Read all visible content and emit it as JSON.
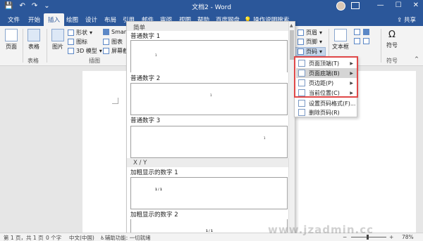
{
  "window": {
    "title": "文档2 - Word",
    "share_label": "共享",
    "tell_me": "操作说明搜索"
  },
  "tabs": [
    "文件",
    "开始",
    "插入",
    "绘图",
    "设计",
    "布局",
    "引用",
    "邮件",
    "审阅",
    "视图",
    "帮助",
    "百度网盘"
  ],
  "active_tab": "插入",
  "ribbon": {
    "pages_label": "页面",
    "table_label": "表格",
    "table_group": "表格",
    "pictures_label": "图片",
    "shapes_label": "形状",
    "icons_label": "图标",
    "model3d_label": "3D 模型",
    "smartart_label": "SmartArt",
    "chart_label": "图表",
    "screenshot_label": "屏幕截图",
    "illustrations_group": "插图",
    "header_label": "页眉",
    "footer_label": "页脚",
    "page_number_label": "页码",
    "textbox_label": "文本框",
    "symbol_label": "符号",
    "symbol_group": "符号",
    "omega": "Ω"
  },
  "gallery": {
    "section1": "简单",
    "item1": "普通数字 1",
    "item2": "普通数字 2",
    "item3": "普通数字 3",
    "section2": "X / Y",
    "item4": "加粗显示的数字 1",
    "item5": "加粗显示的数字 2",
    "num1": "1",
    "num_xy": "1 / 1"
  },
  "page_number_menu": {
    "items": [
      {
        "label": "页面顶端(T)",
        "submenu": true
      },
      {
        "label": "页面底端(B)",
        "submenu": true,
        "highlighted": true
      },
      {
        "label": "页边距(P)",
        "submenu": true
      },
      {
        "label": "当前位置(C)",
        "submenu": true
      },
      {
        "label": "设置页码格式(F)...",
        "submenu": false
      },
      {
        "label": "删除页码(R)",
        "submenu": false
      }
    ]
  },
  "statusbar": {
    "page": "第 1 页，共 1 页",
    "words": "0 个字",
    "language": "中文(中国)",
    "accessibility": "辅助功能: 一切就绪",
    "zoom": "78%"
  },
  "watermark": "www.jzadmin.cc"
}
